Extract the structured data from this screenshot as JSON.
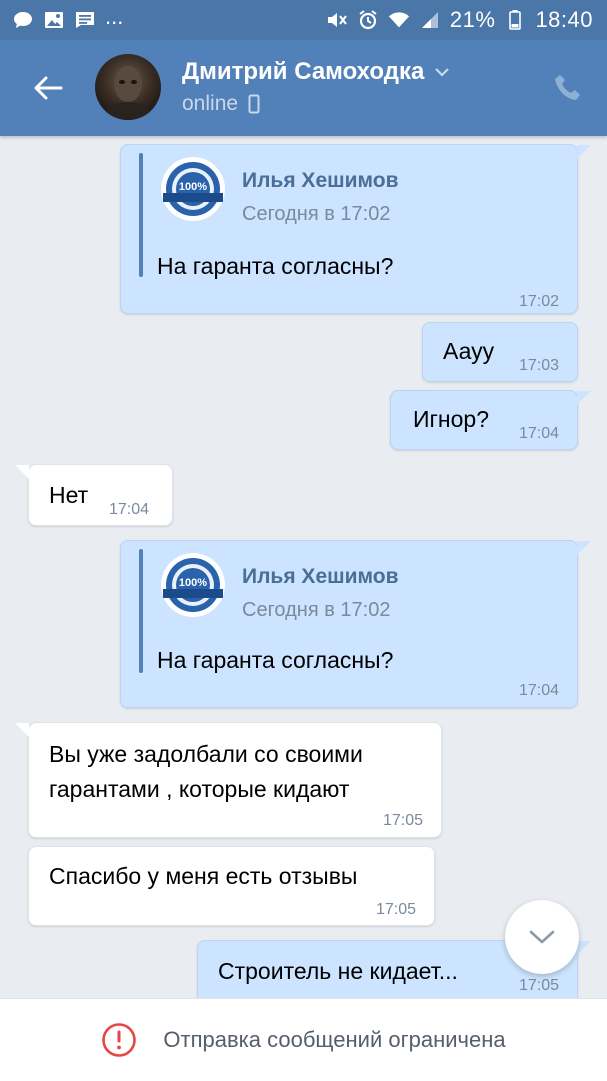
{
  "status_bar": {
    "battery_percent": "21%",
    "time": "18:40",
    "overflow": "...",
    "icons": [
      "chat-notification-icon",
      "image-notification-icon",
      "message-notification-icon",
      "mute-icon",
      "alarm-icon",
      "wifi-icon",
      "signal-icon",
      "battery-icon"
    ]
  },
  "header": {
    "contact_name": "Дмитрий Самоходка",
    "status": "online",
    "colors": {
      "bar": "#5181b8",
      "status_bar": "#4a76a8"
    }
  },
  "messages": [
    {
      "id": "m1",
      "direction": "out",
      "forwarded": {
        "author": "Илья Хешимов",
        "date": "Сегодня в 17:02",
        "text": "На гаранта согласны?"
      },
      "time": "17:02"
    },
    {
      "id": "m2",
      "direction": "out",
      "text": "Аауу",
      "time": "17:03"
    },
    {
      "id": "m3",
      "direction": "out",
      "text": "Игнор?",
      "time": "17:04"
    },
    {
      "id": "m4",
      "direction": "in",
      "text": "Нет",
      "time": "17:04"
    },
    {
      "id": "m5",
      "direction": "out",
      "forwarded": {
        "author": "Илья Хешимов",
        "date": "Сегодня в 17:02",
        "text": "На гаранта согласны?"
      },
      "time": "17:04"
    },
    {
      "id": "m6",
      "direction": "in",
      "lines": [
        "Вы уже задолбали со своими",
        "гарантами , которые кидают"
      ],
      "time": "17:05"
    },
    {
      "id": "m7",
      "direction": "in",
      "text": "Спасибо у меня есть отзывы",
      "time": "17:05"
    },
    {
      "id": "m8",
      "direction": "out",
      "text": "Строитель не кидает...",
      "time": "17:05"
    }
  ],
  "footer": {
    "restriction_text": "Отправка сообщений ограничена",
    "alert_color": "#e64646"
  },
  "badge": {
    "text": "100%"
  }
}
